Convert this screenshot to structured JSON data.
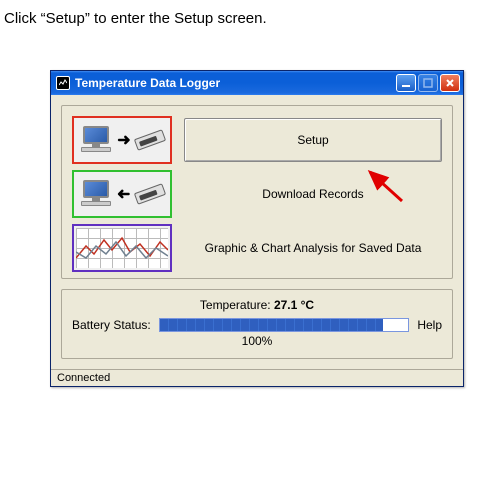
{
  "instruction": "Click “Setup” to enter the Setup screen.",
  "window": {
    "title": "Temperature Data Logger"
  },
  "buttons": {
    "setup": "Setup",
    "download": "Download Records",
    "analysis": "Graphic & Chart Analysis for Saved Data",
    "help": "Help"
  },
  "status": {
    "temperature_label": "Temperature:",
    "temperature_value": "27.1 °C",
    "battery_label": "Battery Status:",
    "battery_percent": "100%"
  },
  "statusbar": {
    "text": "Connected"
  }
}
